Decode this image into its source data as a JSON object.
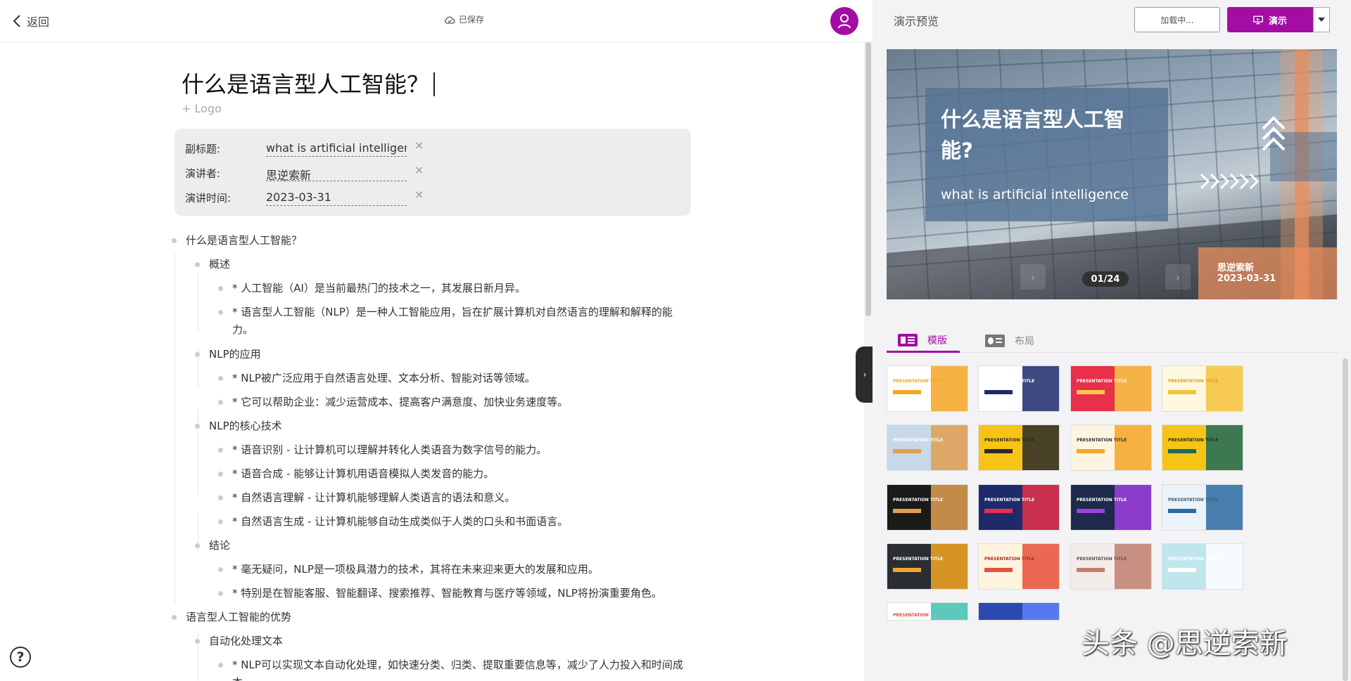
{
  "topbar": {
    "back_label": "返回",
    "saved_label": "已保存"
  },
  "doc": {
    "title": "什么是语言型人工智能？",
    "logo_add": "+ Logo",
    "meta": {
      "subtitle_label": "副标题:",
      "subtitle_value": "what is artificial intelligence",
      "presenter_label": "演讲者:",
      "presenter_value": "思逆索新",
      "time_label": "演讲时间:",
      "time_value": "2023-03-31",
      "clear_icon": "×"
    }
  },
  "outline": [
    "什么是语言型人工智能？",
    "概述",
    "* 人工智能（AI）是当前最热门的技术之一，其发展日新月异。",
    "* 语言型人工智能（NLP）是一种人工智能应用，旨在扩展计算机对自然语言的理解和解释的能力。",
    "NLP的应用",
    "* NLP被广泛应用于自然语言处理、文本分析、智能对话等领域。",
    "* 它可以帮助企业：减少运营成本、提高客户满意度、加快业务速度等。",
    "NLP的核心技术",
    "* 语音识别 - 让计算机可以理解并转化人类语音为数字信号的能力。",
    "* 语音合成 - 能够让计算机用语音模拟人类发音的能力。",
    "* 自然语言理解 - 让计算机能够理解人类语言的语法和意义。",
    "* 自然语言生成 - 让计算机能够自动生成类似于人类的口头和书面语言。",
    "结论",
    "* 毫无疑问，NLP是一项极具潜力的技术，其将在未来迎来更大的发展和应用。",
    "* 特别是在智能客服、智能翻译、搜索推荐、智能教育与医疗等领域，NLP将扮演重要角色。",
    "语言型人工智能的优势",
    "自动化处理文本",
    "* NLP可以实现文本自动化处理，如快速分类、归类、提取重要信息等，减少了人力投入和时间成本。"
  ],
  "help_label": "?",
  "preview": {
    "title": "演示预览",
    "loading_label": "加载中...",
    "present_label": "演示",
    "slide": {
      "title": "什么是语言型人工智能?",
      "subtitle": "what is artificial intelligence",
      "presenter": "思逆索新",
      "date": "2023-03-31",
      "counter": "01/24",
      "prev": "‹",
      "next": "›"
    },
    "tabs": {
      "templates": "模版",
      "layout": "布局"
    },
    "templates": [
      {
        "title": "PRESENTATION TITLE",
        "bg": "#ffffff",
        "accent": "#f5a623",
        "text": "#f5a623"
      },
      {
        "title": "PRESENTATION TITLE",
        "bg": "#ffffff",
        "accent": "#1b2a6b",
        "text": "#ffffff"
      },
      {
        "title": "PRESENTATION TITLE",
        "bg": "#e8304a",
        "accent": "#f7c948",
        "text": "#ffffff"
      },
      {
        "title": "PRESENTATION TITLE",
        "bg": "#fff8e0",
        "accent": "#f5c23a",
        "text": "#e0a020"
      },
      {
        "title": "PRESENTATION TITLE",
        "bg": "#c8d8e8",
        "accent": "#e0a050",
        "text": "#ffffff"
      },
      {
        "title": "PRESENTATION TITLE",
        "bg": "#f6c416",
        "accent": "#2a2a2a",
        "text": "#2a2a2a"
      },
      {
        "title": "PRESENTATION TITLE",
        "bg": "#fdf4e2",
        "accent": "#f5a623",
        "text": "#333333"
      },
      {
        "title": "PRESENTATION TITLE",
        "bg": "#f6c416",
        "accent": "#1b6b5a",
        "text": "#2a2a2a"
      },
      {
        "title": "PRESENTATION TITLE",
        "bg": "#1a1a1a",
        "accent": "#e0a050",
        "text": "#ffffff"
      },
      {
        "title": "PRESENTATION TITLE",
        "bg": "#1f2a6b",
        "accent": "#e8304a",
        "text": "#ffffff"
      },
      {
        "title": "PRESENTATION TITLE",
        "bg": "#1e2a4a",
        "accent": "#a040e0",
        "text": "#ffffff"
      },
      {
        "title": "PRESENTATION TITLE",
        "bg": "#eaf2fa",
        "accent": "#2a6aa0",
        "text": "#4a5a6a"
      },
      {
        "title": "PRESENTATION TITLE",
        "bg": "#2a2e33",
        "accent": "#f5a623",
        "text": "#ffffff"
      },
      {
        "title": "PRESENTATION TITLE",
        "bg": "#fff4e0",
        "accent": "#e8503a",
        "text": "#a03020"
      },
      {
        "title": "PRESENTATION TITLE",
        "bg": "#f4ece8",
        "accent": "#c08070",
        "text": "#555555"
      },
      {
        "title": "PRESENTATION TITLE",
        "bg": "#bfe6ef",
        "accent": "#ffffff",
        "text": "#ffffff"
      },
      {
        "title": "PRESENTATION",
        "bg": "#ffffff",
        "accent": "#40c0b0",
        "text": "#e8503a"
      },
      {
        "title": "",
        "bg": "#2a4ab0",
        "accent": "#6080ff",
        "text": "#ffffff"
      }
    ]
  },
  "watermark": "头条 @思逆索新",
  "colors": {
    "brand": "#a30da3"
  }
}
